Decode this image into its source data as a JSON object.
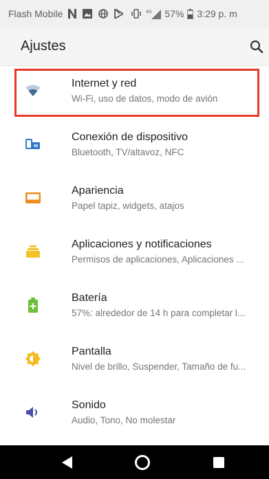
{
  "status_bar": {
    "carrier": "Flash Mobile",
    "battery": "57%",
    "time": "3:29 p. m",
    "icons": [
      "n-icon",
      "image-icon",
      "globe-icon",
      "play-store-icon",
      "vibrate-icon",
      "signal-icon",
      "battery-icon"
    ]
  },
  "app_bar": {
    "title": "Ajustes",
    "search_icon": "search-icon"
  },
  "settings": [
    {
      "title": "Internet y red",
      "summary": "Wi-Fi, uso de datos, modo de avión",
      "icon": "wifi-icon",
      "color": "#3f6b94"
    },
    {
      "title": "Conexión de dispositivo",
      "summary": "Bluetooth, TV/altavoz, NFC",
      "icon": "devices-icon",
      "color": "#2f78c8"
    },
    {
      "title": "Apariencia",
      "summary": "Papel tapiz, widgets, atajos",
      "icon": "wallpaper-icon",
      "color": "#f08c1e"
    },
    {
      "title": "Aplicaciones y notificaciones",
      "summary": "Permisos de aplicaciones, Aplicaciones ...",
      "icon": "apps-icon",
      "color": "#f2c22a"
    },
    {
      "title": "Batería",
      "summary": "57%: alrededor de 14 h para completar l...",
      "icon": "battery-icon",
      "color": "#6bbf3a"
    },
    {
      "title": "Pantalla",
      "summary": "Nivel de brillo, Suspender, Tamaño de fu...",
      "icon": "brightness-icon",
      "color": "#f5b81c"
    },
    {
      "title": "Sonido",
      "summary": "Audio, Tono, No molestar",
      "icon": "volume-icon",
      "color": "#4a4fa8"
    }
  ],
  "highlight_color": "#e8372b",
  "nav_bar": {
    "buttons": [
      "back-icon",
      "home-icon",
      "recents-icon"
    ]
  }
}
